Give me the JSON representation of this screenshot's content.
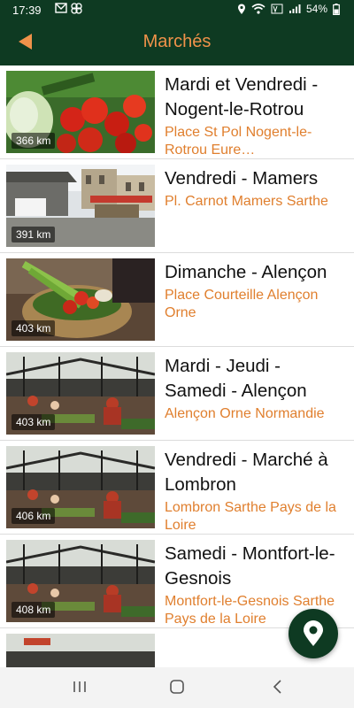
{
  "status": {
    "time": "17:39",
    "battery": "54%",
    "icons": [
      "gmail-icon",
      "pinwheel-icon",
      "location-icon",
      "wifi-icon",
      "volte-icon",
      "signal-icon",
      "battery-icon"
    ]
  },
  "header": {
    "title": "Marchés",
    "back_icon": "back-arrow-icon"
  },
  "markets": [
    {
      "title": "Mardi et Vendredi - Nogent-le-Rotrou",
      "address": "Place St Pol Nogent-le-Rotrou Eure…",
      "distance": "366 km",
      "image": "tomatoes-vegetables"
    },
    {
      "title": "Vendredi - Mamers",
      "address": "Pl. Carnot Mamers Sarthe",
      "distance": "391 km",
      "image": "town-square"
    },
    {
      "title": "Dimanche - Alençon",
      "address": "Place Courteille Alençon Orne",
      "distance": "403 km",
      "image": "vegetable-basket"
    },
    {
      "title": "Mardi - Jeudi - Samedi - Alençon",
      "address": "Alençon Orne Normandie",
      "distance": "403 km",
      "image": "market-hall"
    },
    {
      "title": "Vendredi - Marché à Lombron",
      "address": "Lombron Sarthe Pays de la Loire",
      "distance": "406 km",
      "image": "market-hall"
    },
    {
      "title": "Samedi - Montfort-le-Gesnois",
      "address": "Montfort-le-Gesnois Sarthe Pays de la Loire",
      "distance": "408 km",
      "image": "market-hall"
    }
  ],
  "fab": {
    "icon": "map-pin-icon"
  },
  "navigation": {
    "icons": [
      "recent-apps-icon",
      "home-icon",
      "back-icon"
    ]
  },
  "colors": {
    "bar": "#0e3a22",
    "accent": "#f0924a",
    "address": "#e07f2e"
  }
}
